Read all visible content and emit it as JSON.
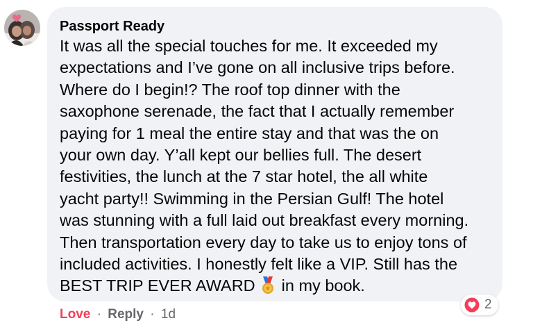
{
  "comment": {
    "author": "Passport Ready",
    "lines": [
      "It was all the special touches for me. It exceeded my",
      "expectations and I’ve gone on all inclusive trips before.",
      "Where do I begin!? The roof top dinner with the",
      "saxophone serenade, the fact that I actually remember",
      "paying for 1 meal the entire stay and that was the on",
      "your own day. Y’all kept our bellies full. The desert",
      "festivities, the lunch at the 7 star hotel, the all white",
      "yacht party!! Swimming in the Persian Gulf! The hotel",
      "was stunning with a full laid out breakfast every morning.",
      "Then transportation every day to take us to enjoy tons of",
      "included activities. I honestly felt like a VIP. Still has the"
    ],
    "last_line_before": "BEST TRIP EVER AWARD",
    "last_line_after": "in my book.",
    "emoji_icon": "medal-icon"
  },
  "reactions": {
    "icon": "heart-reaction-icon",
    "count": "2",
    "color": "#f33e58"
  },
  "actions": {
    "love_label": "Love",
    "separator": "·",
    "reply_label": "Reply",
    "timestamp": "1d"
  },
  "colors": {
    "bubble": "#f0f2f5",
    "text": "#050505",
    "muted": "#65676b",
    "love": "#f33e58"
  }
}
